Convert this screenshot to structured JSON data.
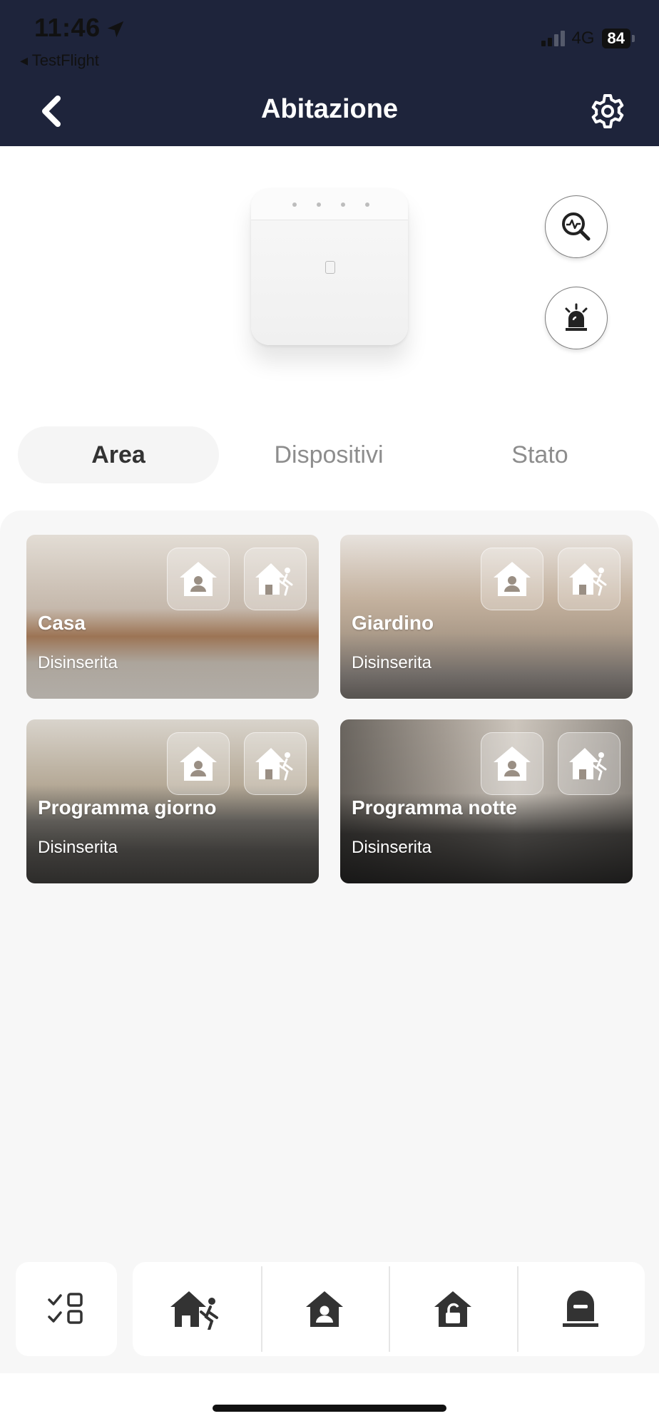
{
  "status_bar": {
    "time": "11:46",
    "back_app": "◂ TestFlight",
    "network": "4G",
    "battery": "84"
  },
  "header": {
    "title": "Abitazione",
    "back_icon": "chevron-left-icon",
    "settings_icon": "gear-icon"
  },
  "device_actions": [
    {
      "icon": "diagnostic-search-icon"
    },
    {
      "icon": "siren-icon"
    }
  ],
  "tabs": [
    {
      "label": "Area",
      "active": true
    },
    {
      "label": "Dispositivi",
      "active": false
    },
    {
      "label": "Stato",
      "active": false
    }
  ],
  "areas": [
    {
      "name": "Casa",
      "status": "Disinserita"
    },
    {
      "name": "Giardino",
      "status": "Disinserita"
    },
    {
      "name": "Programma giorno",
      "status": "Disinserita"
    },
    {
      "name": "Programma notte",
      "status": "Disinserita"
    }
  ],
  "bottom_bar": {
    "checklist_icon": "checklist-icon",
    "actions": [
      {
        "icon": "away-arm-icon"
      },
      {
        "icon": "stay-arm-icon"
      },
      {
        "icon": "disarm-icon"
      },
      {
        "icon": "clear-alarm-icon"
      }
    ]
  },
  "colors": {
    "header_bg": "#1e243b",
    "panel_bg": "#f7f7f7",
    "icon_dark": "#333333"
  }
}
